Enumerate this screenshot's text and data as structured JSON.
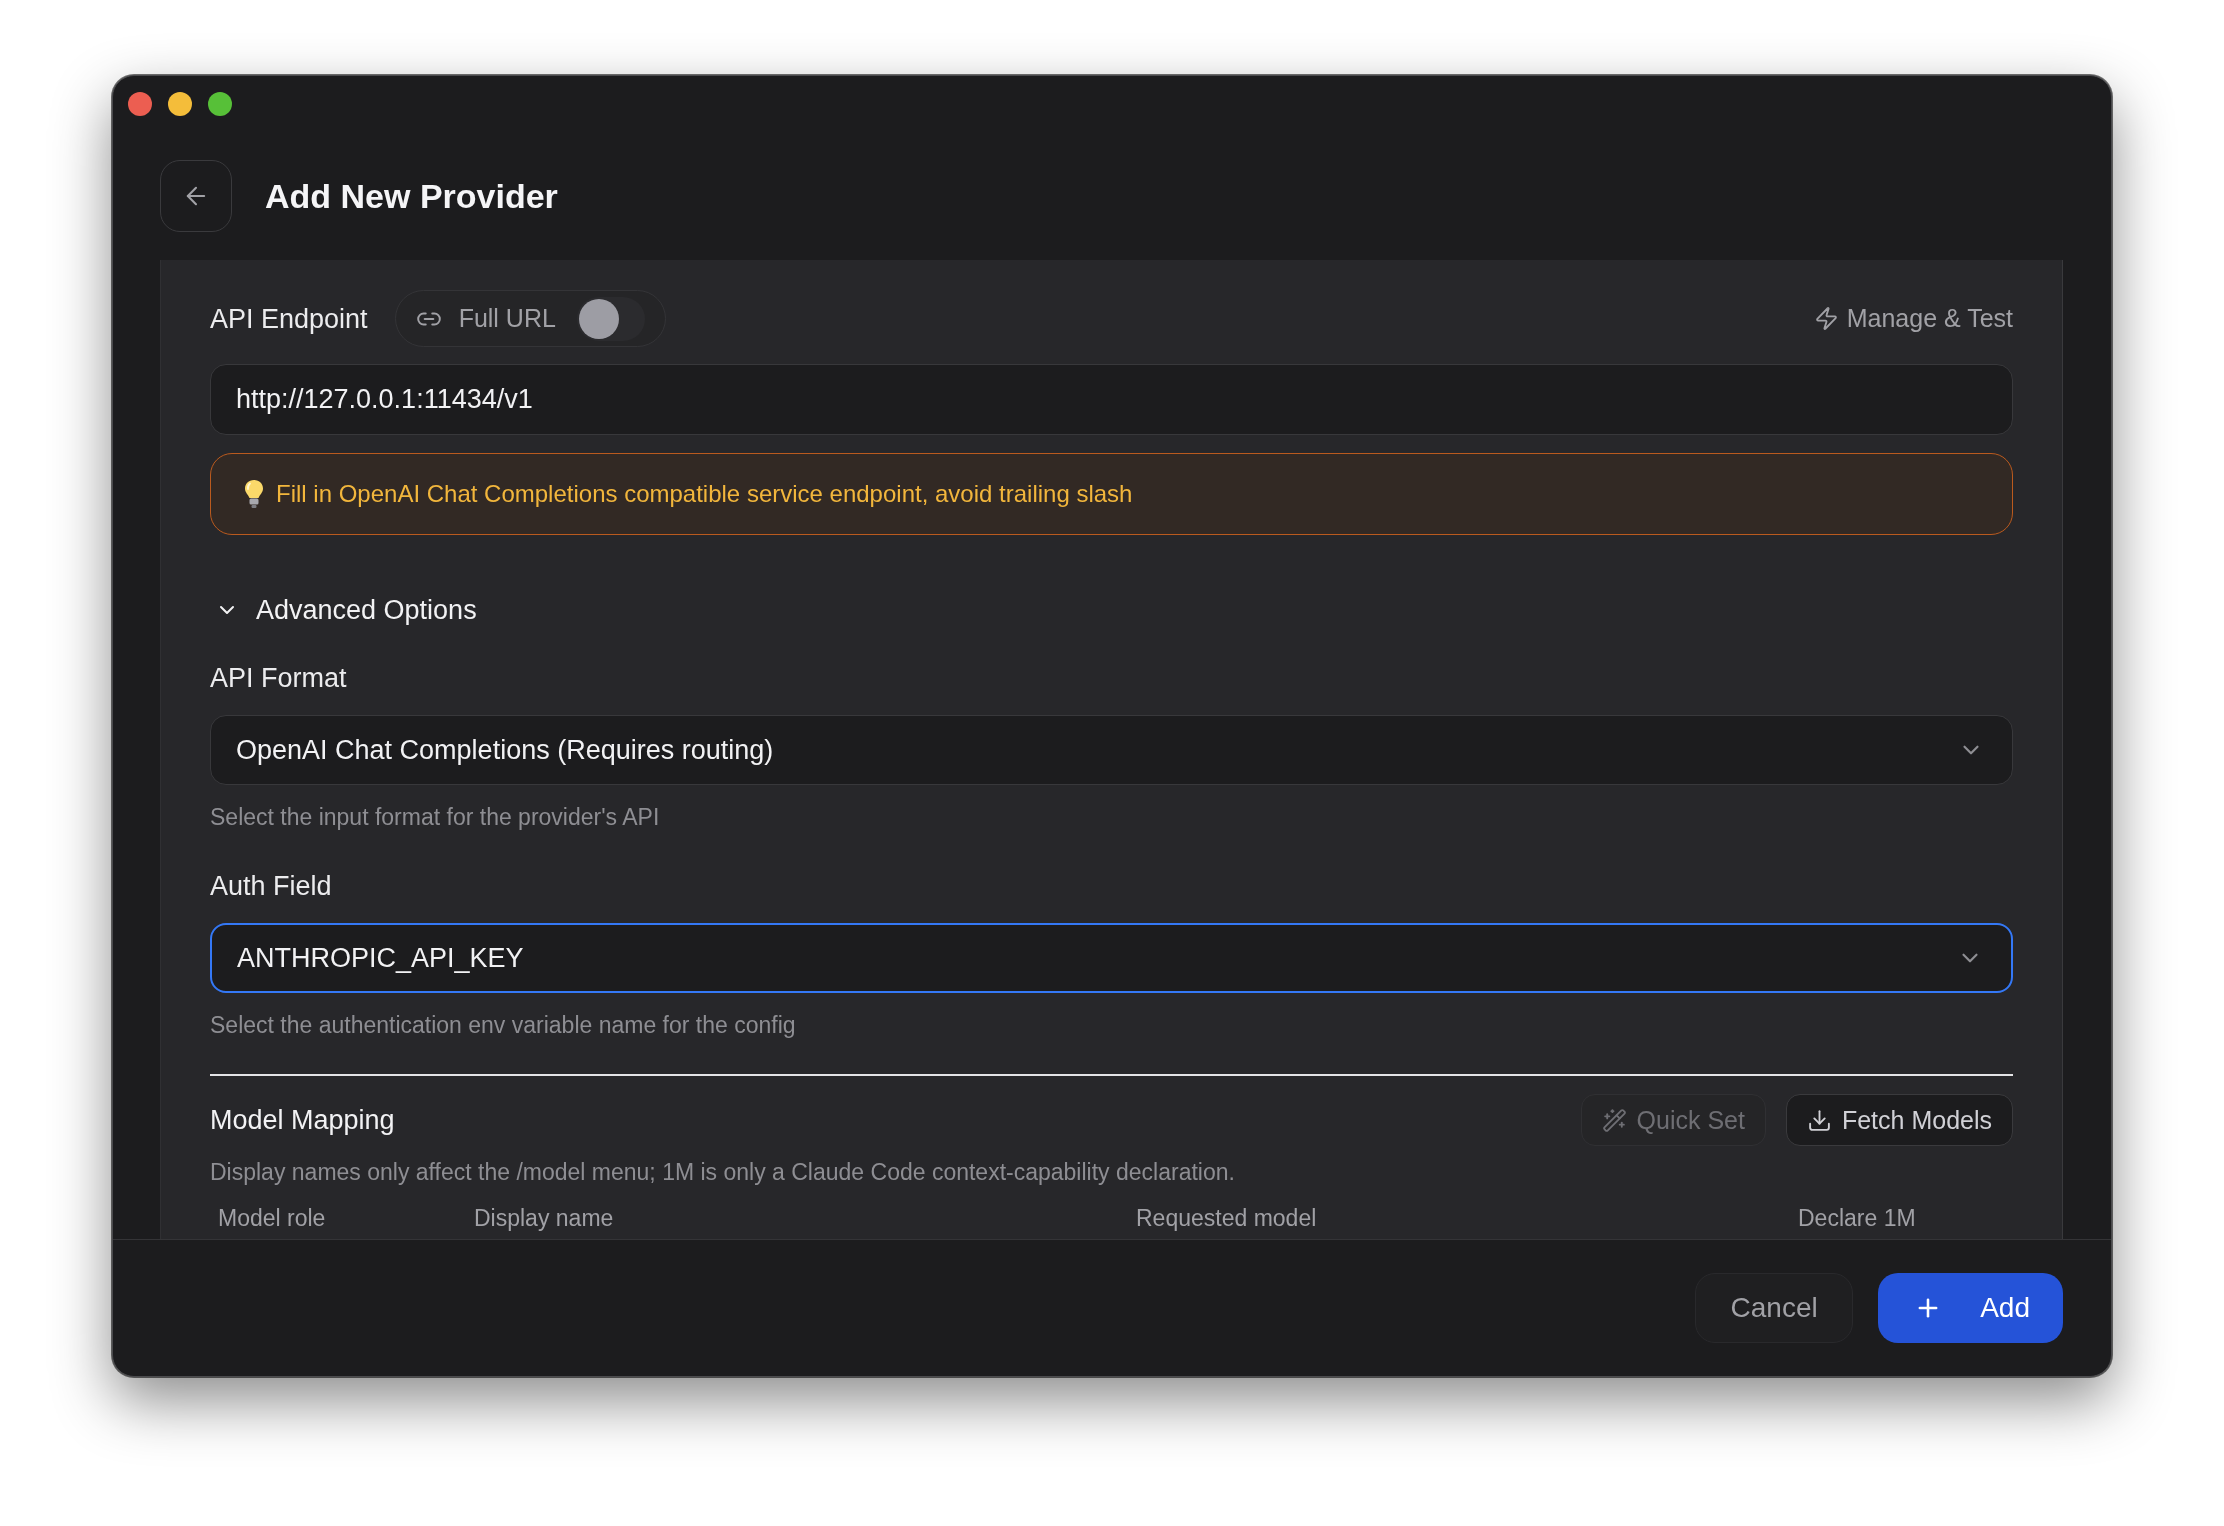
{
  "header": {
    "title": "Add New Provider"
  },
  "endpoint": {
    "label": "API Endpoint",
    "full_url": {
      "label": "Full URL",
      "on": false
    },
    "manage_link": "Manage & Test",
    "url": "http://127.0.0.1:11434/v1",
    "hint": "Fill in OpenAI Chat Completions compatible service endpoint, avoid trailing slash"
  },
  "advanced": {
    "label": "Advanced Options",
    "expanded": true,
    "fields": [
      {
        "label": "API Format",
        "value": "OpenAI Chat Completions (Requires routing)",
        "help": "Select the input format for the provider's API",
        "focused": false
      },
      {
        "label": "Auth Field",
        "value": "ANTHROPIC_API_KEY",
        "help": "Select the authentication env variable name for the config",
        "focused": true
      }
    ]
  },
  "model_mapping": {
    "title": "Model Mapping",
    "buttons": [
      {
        "label": "Quick Set",
        "kind": "wand",
        "disabled": true
      },
      {
        "label": "Fetch Models",
        "kind": "download",
        "disabled": false
      }
    ],
    "description": "Display names only affect the /model menu; 1M is only a Claude Code context-capability declaration.",
    "table": {
      "columns": [
        "Model role",
        "Display name",
        "Requested model",
        "Declare 1M"
      ]
    }
  },
  "footer": {
    "buttons": [
      {
        "label": "Cancel",
        "kind": "secondary"
      },
      {
        "label": "Add",
        "kind": "primary"
      }
    ]
  }
}
